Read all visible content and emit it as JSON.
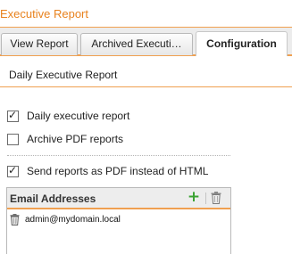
{
  "window": {
    "title": "Executive Report"
  },
  "tabs": [
    {
      "label": "View Report"
    },
    {
      "label": "Archived Executi…"
    },
    {
      "label": "Configuration"
    }
  ],
  "section": {
    "title": "Daily Executive Report"
  },
  "options": [
    {
      "label": "Daily executive report",
      "checked": true
    },
    {
      "label": "Archive PDF reports",
      "checked": false
    },
    {
      "label": "Send reports as PDF instead of HTML",
      "checked": true
    }
  ],
  "email_panel": {
    "title": "Email Addresses",
    "add_icon": "plus-icon",
    "delete_icon": "trash-icon",
    "rows": [
      {
        "address": "admin@mydomain.local"
      }
    ]
  },
  "colors": {
    "accent": "#e8821e",
    "add_green": "#3aa232"
  }
}
